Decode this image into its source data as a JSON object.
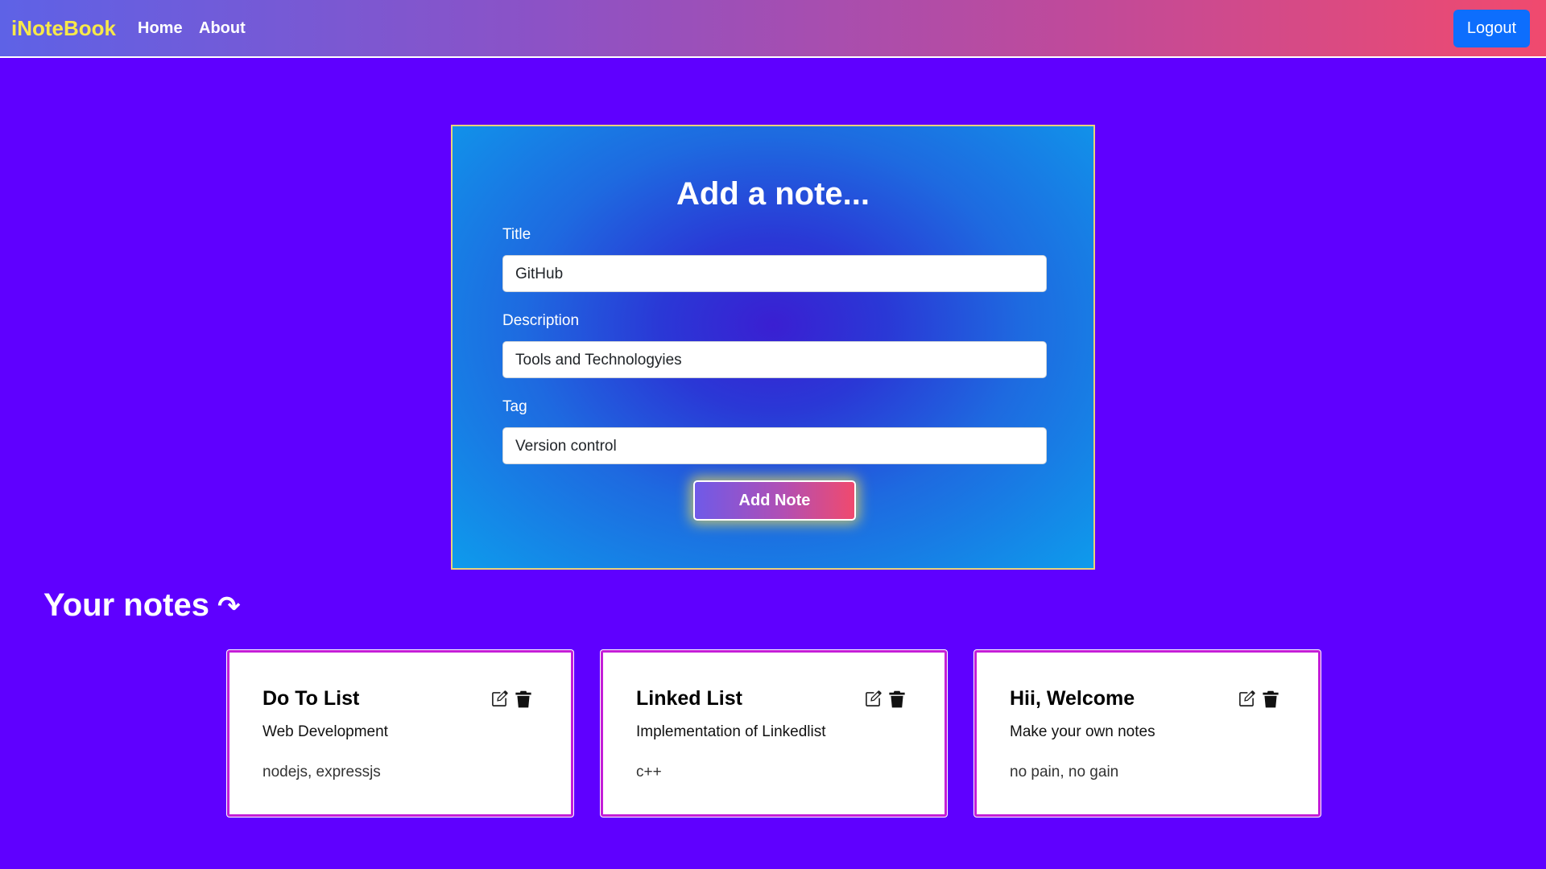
{
  "navbar": {
    "brand": "iNoteBook",
    "links": [
      "Home",
      "About"
    ],
    "logout_label": "Logout"
  },
  "add_note": {
    "heading": "Add a note...",
    "title_label": "Title",
    "title_value": "GitHub",
    "description_label": "Description",
    "description_value": "Tools and Technologyies",
    "tag_label": "Tag",
    "tag_value": "Version control",
    "submit_label": "Add Note"
  },
  "notes_section": {
    "heading": "Your notes",
    "heading_icon": "↷"
  },
  "notes": [
    {
      "title": "Do To List",
      "description": "Web Development",
      "tag": "nodejs, expressjs"
    },
    {
      "title": "Linked List",
      "description": "Implementation of Linkedlist",
      "tag": "c++"
    },
    {
      "title": "Hii, Welcome",
      "description": "Make your own notes",
      "tag": "no pain, no gain"
    }
  ],
  "colors": {
    "background": "#5f00ff",
    "brand": "#f7e84a",
    "logout": "#0d6efd",
    "card_border": "#c41dd8"
  }
}
